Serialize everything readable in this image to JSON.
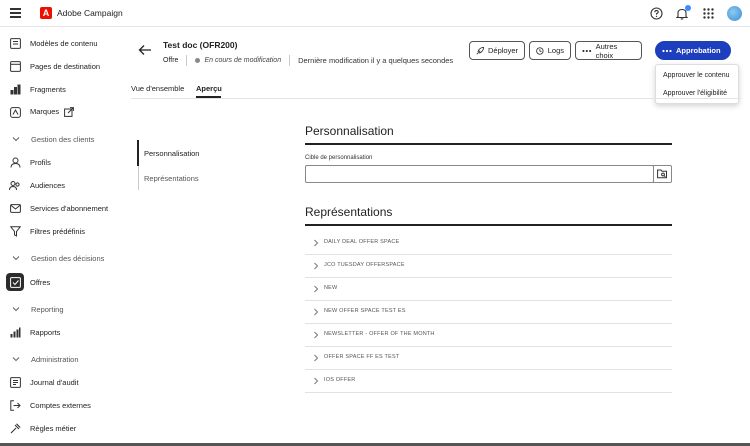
{
  "app": {
    "title": "Adobe Campaign",
    "logo_letter": "A"
  },
  "topbar": {
    "icons": [
      "help-icon",
      "bell-icon",
      "apps-grid-icon",
      "avatar"
    ]
  },
  "sidebar": {
    "items": [
      {
        "label": "Modèles de contenu",
        "icon": "template-icon"
      },
      {
        "label": "Pages de destination",
        "icon": "landing-page-icon"
      },
      {
        "label": "Fragments",
        "icon": "fragments-icon"
      },
      {
        "label": "Marques",
        "icon": "brand-icon"
      }
    ],
    "section_clients": "Gestion des clients",
    "clients_items": [
      {
        "label": "Profils",
        "icon": "user-icon"
      },
      {
        "label": "Audiences",
        "icon": "audiences-icon"
      },
      {
        "label": "Services d'abonnement",
        "icon": "subscription-icon"
      },
      {
        "label": "Filtres prédéfinis",
        "icon": "filter-icon"
      }
    ],
    "section_decisions": "Gestion des décisions",
    "decisions_items": [
      {
        "label": "Offres",
        "icon": "offers-icon",
        "active": true
      }
    ],
    "section_reporting": "Reporting",
    "reporting_items": [
      {
        "label": "Rapports",
        "icon": "reports-icon"
      }
    ],
    "section_admin": "Administration",
    "admin_items": [
      {
        "label": "Journal d'audit",
        "icon": "audit-icon"
      },
      {
        "label": "Comptes externes",
        "icon": "external-accounts-icon"
      },
      {
        "label": "Règles métier",
        "icon": "business-rules-icon"
      }
    ]
  },
  "header": {
    "title": "Test doc (OFR200)",
    "type": "Offre",
    "status": "En cours de modification",
    "modified": "Dernière modification il y a quelques secondes",
    "buttons": {
      "deploy": "Déployer",
      "logs": "Logs",
      "more": "Autres choix",
      "approval": "Approbation"
    }
  },
  "approval_menu": {
    "items": [
      "Approuver le contenu",
      "Approuver l'éligibilité"
    ]
  },
  "tabs": {
    "overview": "Vue d'ensemble",
    "preview": "Aperçu",
    "active": "preview"
  },
  "anchor_nav": {
    "items": [
      "Personnalisation",
      "Représentations"
    ],
    "active": 0
  },
  "personalization": {
    "title": "Personnalisation",
    "field_label": "Cible de personnalisation",
    "field_value": ""
  },
  "representations": {
    "title": "Représentations",
    "items": [
      "DAILY DEAL OFFER SPACE",
      "JCO TUESDAY OFFERSPACE",
      "NEW",
      "NEW OFFER SPACE TEST ES",
      "NEWSLETTER - OFFER OF THE MONTH",
      "OFFER SPACE FF ES TEST",
      "IOS OFFER"
    ]
  },
  "colors": {
    "primary": "#1d3ebd",
    "adobe_red": "#eb1000",
    "active_icon_bg": "#2c2c2c"
  }
}
